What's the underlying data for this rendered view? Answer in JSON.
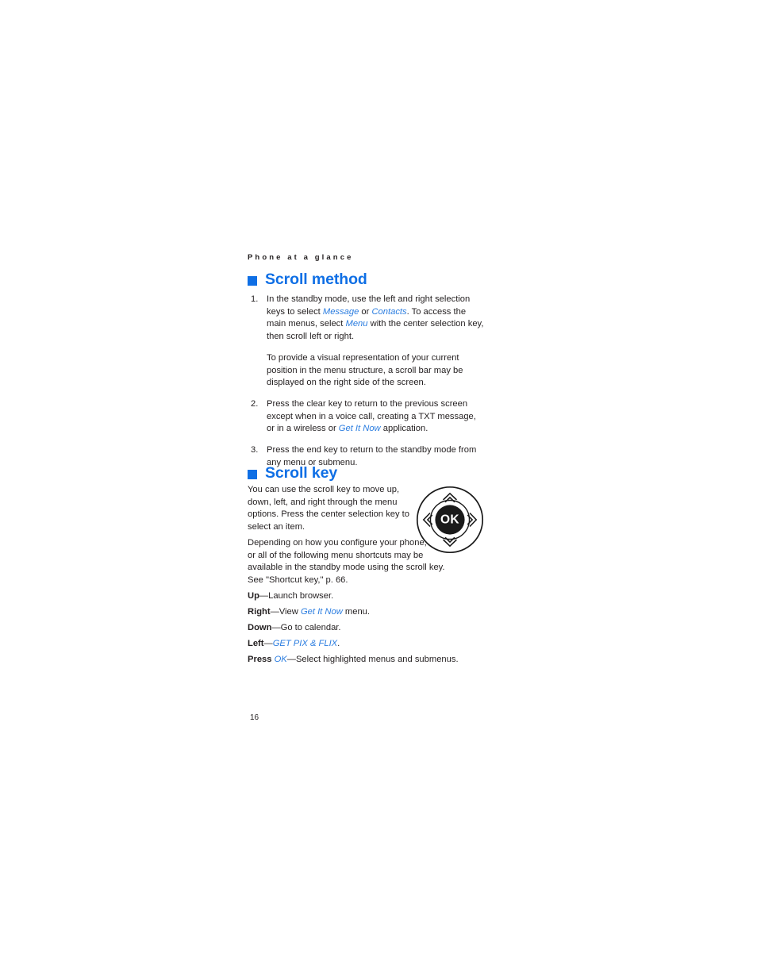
{
  "page": {
    "running_header": "Phone at a glance",
    "page_number": "16",
    "accent_color": "#0f6fe5",
    "inline_term_color": "#2b7de0",
    "text_color": "#231f20"
  },
  "sections": [
    {
      "id": "scroll-method",
      "heading": "Scroll method",
      "bullet_icon": "square-bullet-icon",
      "steps": [
        {
          "number": "1.",
          "parts": [
            {
              "type": "text",
              "value": "In the standby mode, use the left and right selection keys to select "
            },
            {
              "type": "term",
              "value": "Message"
            },
            {
              "type": "text",
              "value": " or "
            },
            {
              "type": "term",
              "value": "Contacts"
            },
            {
              "type": "text",
              "value": ". To access the main menus, select "
            },
            {
              "type": "term",
              "value": "Menu"
            },
            {
              "type": "text",
              "value": " with the center selection key, then scroll left or right."
            }
          ],
          "sub_paragraph": "To provide a visual representation of your current position in the menu structure, a scroll bar may be displayed on the right side of the screen."
        },
        {
          "number": "2.",
          "parts": [
            {
              "type": "text",
              "value": "Press the clear key to return to the previous screen except when in a voice call, creating a TXT message, or in a wireless or "
            },
            {
              "type": "term",
              "value": "Get It Now"
            },
            {
              "type": "text",
              "value": " application."
            }
          ],
          "sub_paragraph": ""
        },
        {
          "number": "3.",
          "parts": [
            {
              "type": "text",
              "value": "Press the end key to return to the standby mode from any menu or submenu."
            }
          ],
          "sub_paragraph": ""
        }
      ]
    },
    {
      "id": "scroll-key",
      "heading": "Scroll key",
      "bullet_icon": "square-bullet-icon",
      "paragraph_1": "You can use the scroll key to move up, down, left, and right through the menu options. Press the center selection key to select an item.",
      "paragraph_2": "Depending on how you configure your phone, some or all of the following menu shortcuts may be available in the standby mode using the scroll key. See \"Shortcut key,\" p. 66.",
      "figure": {
        "name": "scroll-key-diagram",
        "center_label": "OK",
        "directions": [
          "up",
          "right",
          "down",
          "left"
        ]
      },
      "shortcuts": [
        {
          "id": "up",
          "parts": [
            {
              "type": "bold",
              "value": "Up"
            },
            {
              "type": "text",
              "value": "—Launch browser."
            }
          ]
        },
        {
          "id": "right",
          "parts": [
            {
              "type": "bold",
              "value": "Right"
            },
            {
              "type": "text",
              "value": "—View "
            },
            {
              "type": "term",
              "value": "Get It Now"
            },
            {
              "type": "text",
              "value": " menu."
            }
          ]
        },
        {
          "id": "down",
          "parts": [
            {
              "type": "bold",
              "value": "Down"
            },
            {
              "type": "text",
              "value": "—Go to calendar."
            }
          ]
        },
        {
          "id": "left",
          "parts": [
            {
              "type": "bold",
              "value": "Left"
            },
            {
              "type": "text",
              "value": "—"
            },
            {
              "type": "term",
              "value": "GET PIX & FLIX"
            },
            {
              "type": "text",
              "value": "."
            }
          ]
        },
        {
          "id": "press",
          "parts": [
            {
              "type": "bold",
              "value": "Press "
            },
            {
              "type": "term",
              "value": "OK"
            },
            {
              "type": "text",
              "value": "—Select highlighted menus and submenus."
            }
          ]
        }
      ]
    }
  ]
}
